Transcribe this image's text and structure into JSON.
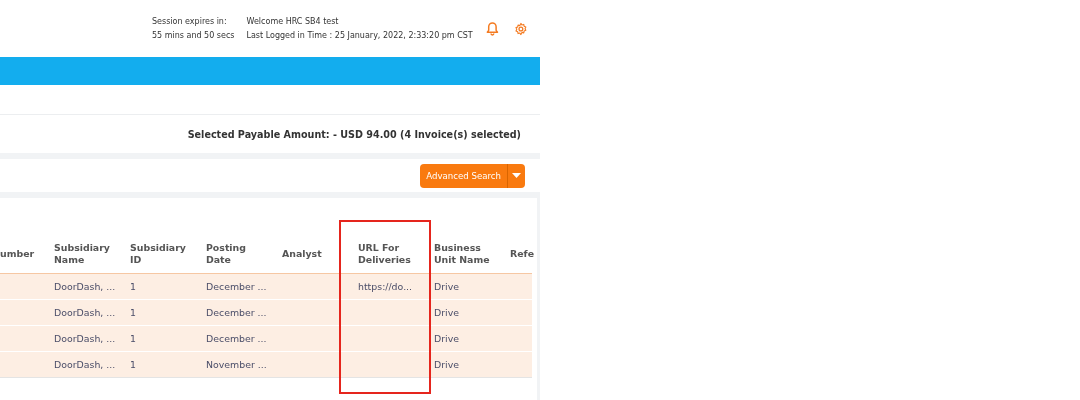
{
  "header": {
    "session_label": "Session expires in:",
    "session_time": "55 mins and 50 secs",
    "welcome": "Welcome HRC SB4 test",
    "last_login": "Last Logged in Time : 25 January, 2022, 2:33:20 pm CST"
  },
  "summary": "Selected Payable Amount: - USD 94.00 (4 Invoice(s) selected)",
  "search_button": "Advanced Search",
  "table": {
    "columns": [
      "umber",
      "Subsidiary Name",
      "Subsidiary ID",
      "Posting Date",
      "Analyst",
      "URL For Deliveries",
      "Business Unit Name",
      "Refe"
    ],
    "rows": [
      {
        "selected": true,
        "cells": [
          null,
          "DoorDash, ...",
          "1",
          "December ...",
          null,
          "https://do...",
          "Drive",
          null
        ]
      },
      {
        "selected": true,
        "cells": [
          null,
          "DoorDash, ...",
          "1",
          "December ...",
          null,
          null,
          "Drive",
          null
        ]
      },
      {
        "selected": true,
        "cells": [
          null,
          "DoorDash, ...",
          "1",
          "December ...",
          null,
          null,
          "Drive",
          null
        ]
      },
      {
        "selected": true,
        "cells": [
          null,
          "DoorDash, ...",
          "1",
          "November ...",
          null,
          null,
          "Drive",
          null
        ]
      }
    ]
  }
}
